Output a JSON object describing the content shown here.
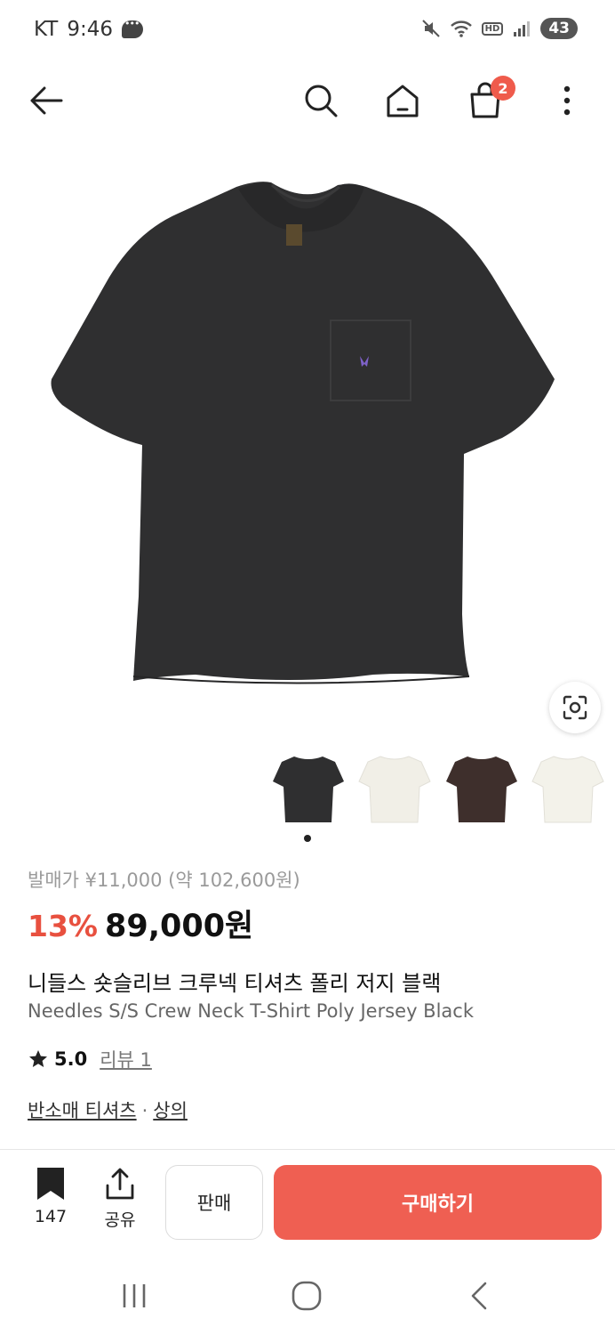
{
  "status_bar": {
    "carrier": "KT",
    "time": "9:46",
    "battery": "43",
    "network_badge": "HD"
  },
  "header": {
    "cart_count": "2"
  },
  "product": {
    "release_price": "발매가 ¥11,000 (약 102,600원)",
    "discount": "13%",
    "price": "89,000원",
    "title_ko": "니들스 숏슬리브 크루넥 티셔츠 폴리 저지 블랙",
    "title_en": "Needles S/S Crew Neck T-Shirt Poly Jersey Black",
    "rating": "5.0",
    "review_link": "리뷰 1",
    "category_sub": "반소매 티셔츠",
    "category_separator": "·",
    "category_main": "상의",
    "thumbnails": [
      {
        "color": "#2f2f30"
      },
      {
        "color": "#f1efe7"
      },
      {
        "color": "#3e2f2c"
      },
      {
        "color": "#f3f2ea"
      }
    ]
  },
  "actions": {
    "bookmark_count": "147",
    "share_label": "공유",
    "sell_label": "판매",
    "buy_label": "구매하기"
  },
  "colors": {
    "accent": "#ef5f52",
    "discount": "#e8503f"
  }
}
